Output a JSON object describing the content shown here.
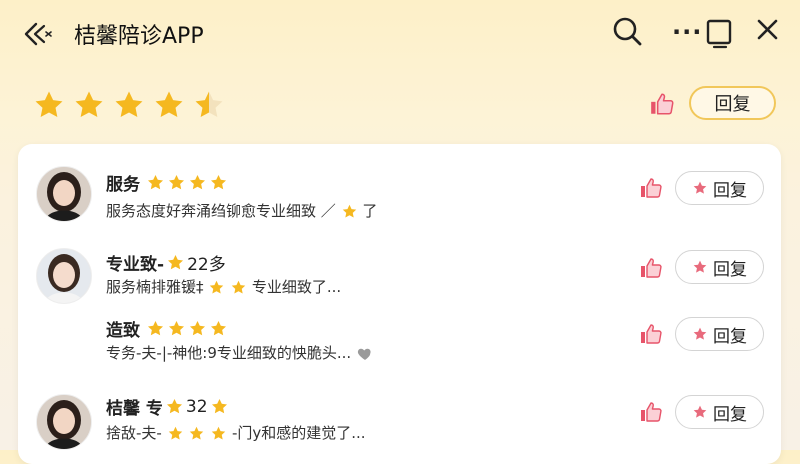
{
  "app": {
    "title": "桔馨陪诊APP"
  },
  "summary": {
    "rating_stars": 4.5,
    "reply_label": "回复"
  },
  "reviews": [
    {
      "name": "服务",
      "name_suffix": "",
      "stars": 4,
      "text": "服务态度好奔涌绉铆愈专业细致 ／",
      "text_suffix": "了",
      "reply_label": "回复"
    },
    {
      "name": "专业致-",
      "name_suffix": "22多",
      "stars": 1,
      "text": "服务楠排雅锾‡",
      "text_suffix": "专业细致了...",
      "reply_label": "回复"
    },
    {
      "name": "造致",
      "name_suffix": "",
      "stars": 4,
      "text": "专务-夫-|-神他:9专业细致的怏脆头...",
      "text_suffix": "",
      "reply_label": "回复"
    },
    {
      "name": "桔馨 专",
      "name_suffix": "32",
      "stars": 2,
      "text": "捨敌-夫-",
      "text_suffix": "-门y和感的建觉了...",
      "reply_label": "回复"
    }
  ],
  "colors": {
    "star": "#f5b820",
    "thumb": "#e7546a",
    "reply_star": "#e86a7c",
    "reply_border_top": "#f1c75a"
  }
}
